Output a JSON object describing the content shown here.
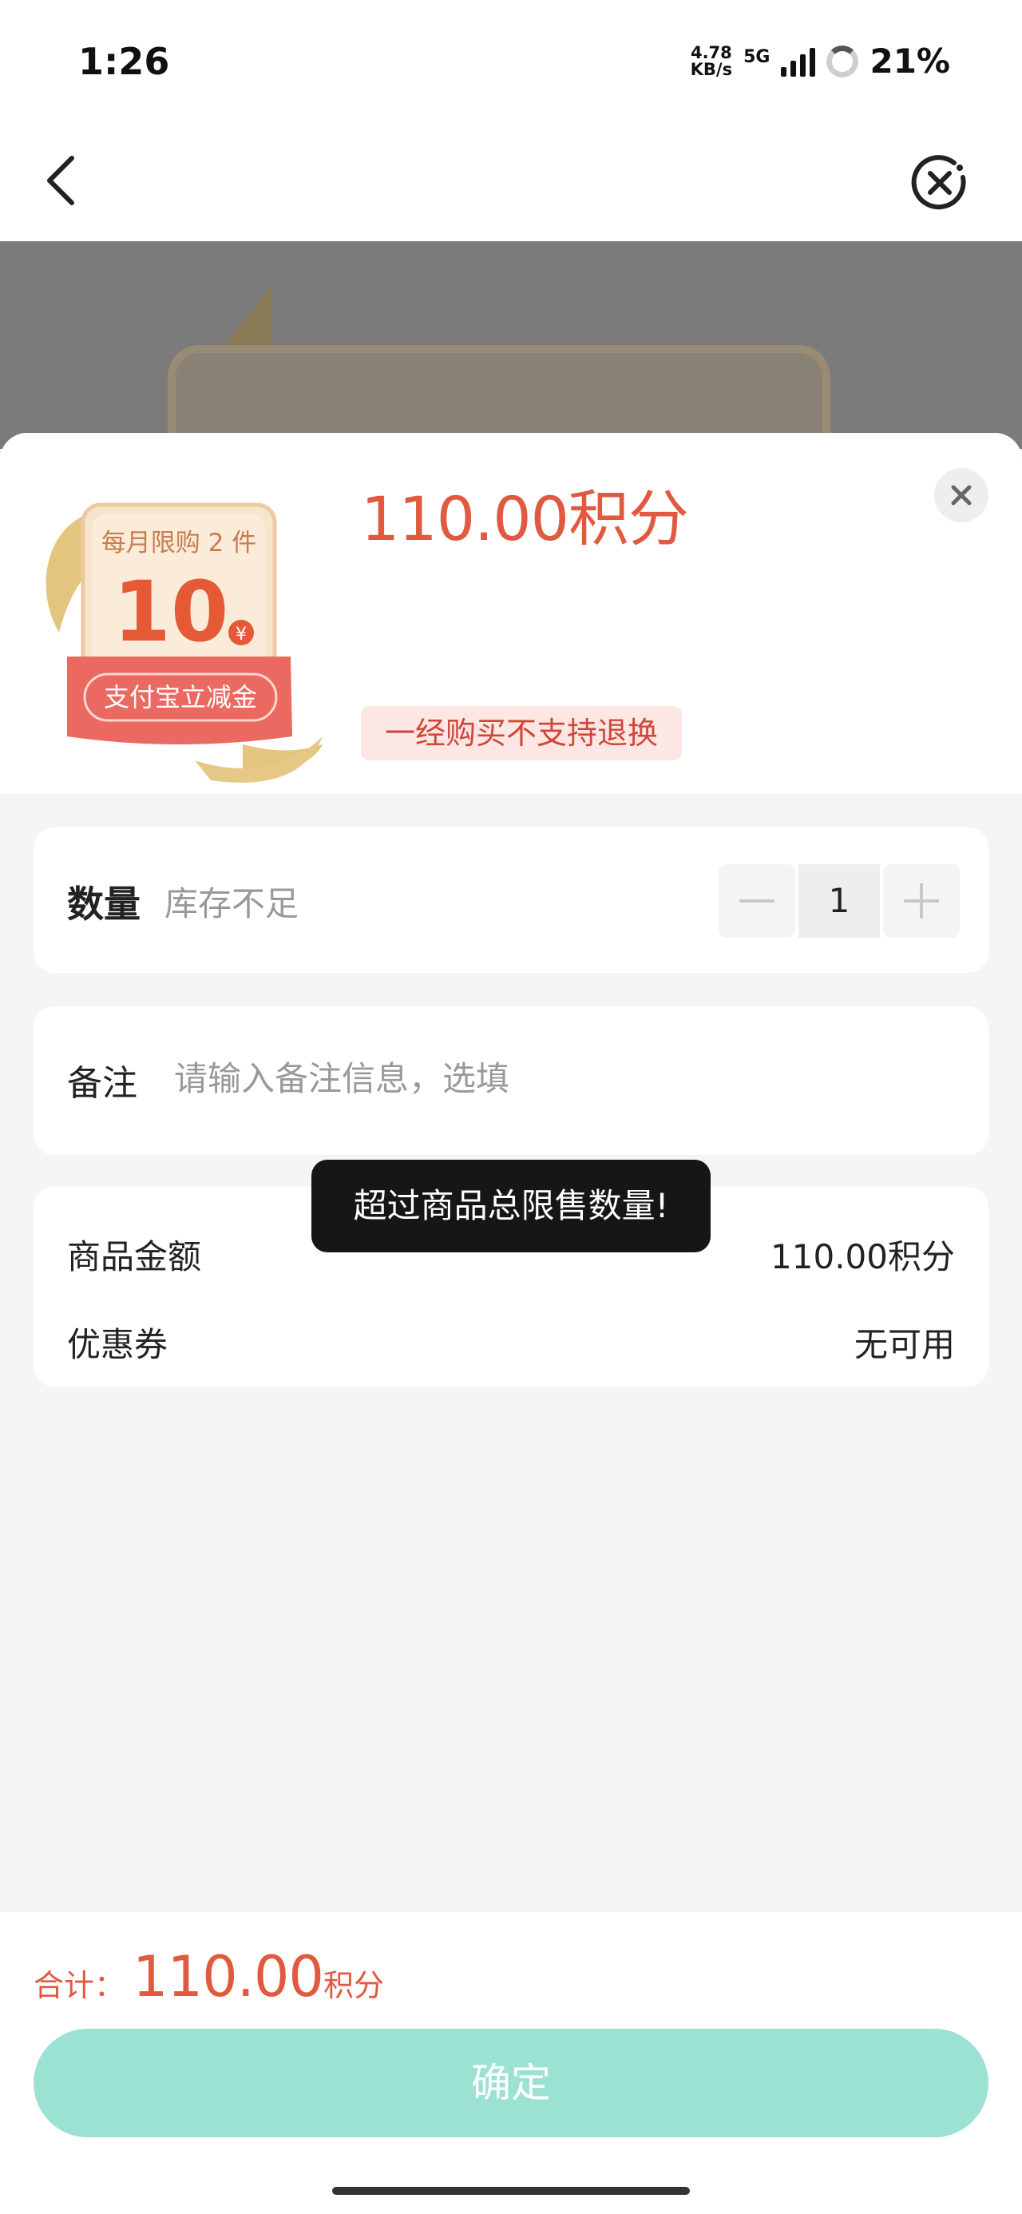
{
  "status_bar": {
    "time": "1:26",
    "net_speed_value": "4.78",
    "net_speed_unit": "KB/s",
    "network": "5G",
    "battery": "21%"
  },
  "nav": {
    "back_icon": "chevron-left-icon",
    "close_icon": "circle-x-icon"
  },
  "product": {
    "badge_top": "每月限购 2 件",
    "badge_value": "10",
    "badge_currency": "¥",
    "badge_bottom": "支付宝立减金",
    "price": "110.00积分",
    "refund_notice": "一经购买不支持退换"
  },
  "quantity": {
    "label": "数量",
    "stock_status": "库存不足",
    "value": "1"
  },
  "note": {
    "label": "备注",
    "placeholder": "请输入备注信息，选填",
    "value": ""
  },
  "summary": {
    "product_amount_label": "商品金额",
    "product_amount_value": "110.00积分",
    "coupon_label": "优惠券",
    "coupon_value": "无可用"
  },
  "toast": {
    "message": "超过商品总限售数量!"
  },
  "footer": {
    "total_label": "合计：",
    "total_value": "110.00",
    "total_unit": "积分",
    "confirm_label": "确定"
  },
  "colors": {
    "accent": "#e05a40",
    "confirm_button": "#9be2d3",
    "toast_bg": "#161616"
  }
}
